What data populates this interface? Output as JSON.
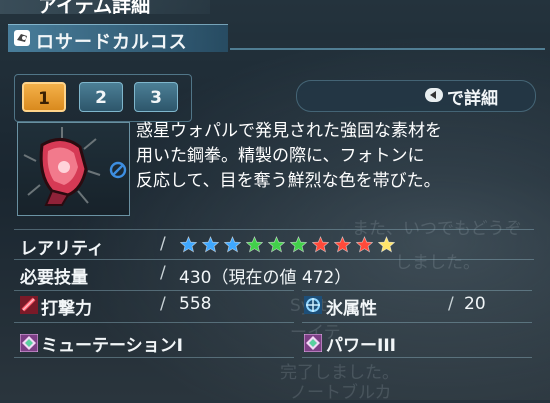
{
  "window": {
    "title": "アイテム詳細"
  },
  "item": {
    "name": "ロサードカルコス",
    "description_lines": [
      "惑星ウォパルで発見された強固な素材を",
      "用いた鋼拳。精製の際に、フォトンに",
      "反応して、目を奪う鮮烈な色を帯びた。"
    ]
  },
  "tabs": [
    {
      "label": "1",
      "active": true
    },
    {
      "label": "2",
      "active": false
    },
    {
      "label": "3",
      "active": false
    }
  ],
  "detail_hint": {
    "label": "で詳細",
    "icon": "controller-button-icon"
  },
  "stats": {
    "rarity": {
      "label": "レアリティ",
      "value": 10,
      "star_colors": [
        "#3fa8ff",
        "#3fa8ff",
        "#3fa8ff",
        "#42d14a",
        "#42d14a",
        "#42d14a",
        "#ff4a3a",
        "#ff4a3a",
        "#ff4a3a",
        "#ffe46a"
      ]
    },
    "required": {
      "label": "必要技量",
      "value": "430（現在の値 472）"
    },
    "attack": {
      "label": "打撃力",
      "value": "558",
      "icon": "strike-power-icon"
    },
    "element": {
      "label": "氷属性",
      "value": "20",
      "icon": "ice-element-icon"
    },
    "slot1": {
      "label": "ミューテーションI"
    },
    "slot2": {
      "label": "パワーIII"
    }
  },
  "background_text": [
    "また、いつでもどうぞ",
    "しました。",
    "Syst",
    "ーイテ",
    "完了しました。",
    "ノートブルカ"
  ],
  "colors": {
    "accent": "#f4b14a",
    "panel": "#2d566b"
  }
}
